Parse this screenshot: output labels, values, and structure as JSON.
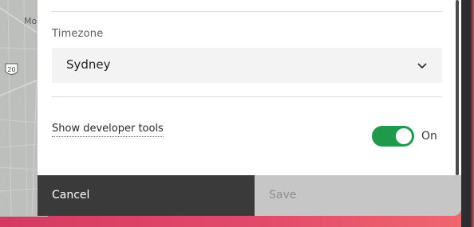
{
  "map": {
    "place_label": "Mo",
    "route_number": "20"
  },
  "settings": {
    "timezone": {
      "label": "Timezone",
      "selected": "Sydney",
      "chevron_icon": "chevron-down-icon"
    },
    "developer_tools": {
      "label": "Show developer tools",
      "enabled": true,
      "state_text": "On",
      "toggle_color": "#1f9a4a"
    }
  },
  "footer": {
    "cancel_label": "Cancel",
    "save_label": "Save",
    "save_disabled": true
  },
  "colors": {
    "background_gradient_start": "#d63a63",
    "background_gradient_end": "#f0686e",
    "cancel_bg": "#3a3a3a",
    "save_bg": "#c6c6c6"
  }
}
